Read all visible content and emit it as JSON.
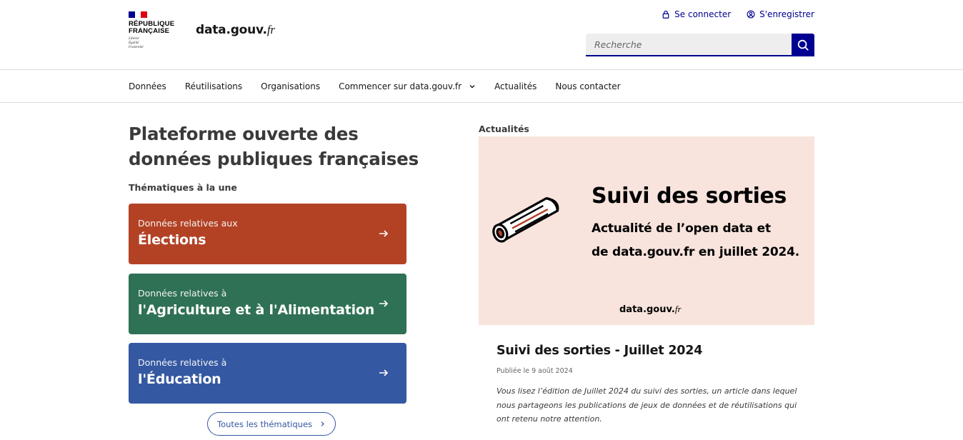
{
  "header": {
    "republique": "République\nFrançaise",
    "republique_lines": [
      "République",
      "Française"
    ],
    "devise_lines": [
      "Liberté",
      "Égalité",
      "Fraternité"
    ],
    "site_name": "data.gouv.",
    "site_tld": "fr",
    "login_label": "Se connecter",
    "register_label": "S'enregistrer",
    "search_placeholder": "Recherche",
    "flag_colors": [
      "#000091",
      "#ffffff",
      "#e1000f"
    ]
  },
  "nav": {
    "items": [
      {
        "label": "Données"
      },
      {
        "label": "Réutilisations"
      },
      {
        "label": "Organisations"
      },
      {
        "label": "Commencer sur data.gouv.fr",
        "has_dropdown": true
      },
      {
        "label": "Actualités"
      },
      {
        "label": "Nous contacter"
      }
    ]
  },
  "hero": {
    "title": "Plateforme ouverte des données publiques françaises",
    "themes_heading": "Thématiques à la une",
    "themes": [
      {
        "prefix": "Données relatives aux",
        "name": "Élections",
        "color": "#b34225"
      },
      {
        "prefix": "Données relatives à",
        "name": "l'Agriculture et à l'Alimentation",
        "color": "#2f7154"
      },
      {
        "prefix": "Données relatives à",
        "name": "l'Éducation",
        "color": "#3558a2"
      }
    ],
    "all_themes_label": "Toutes les thématiques"
  },
  "news": {
    "heading": "Actualités",
    "banner": {
      "title": "Suivi des sorties",
      "subtitle_line1": "Actualité de l’open data et",
      "subtitle_line2": "de data.gouv.fr en juillet 2024.",
      "logo_name": "data.gouv.",
      "logo_tld": "fr",
      "background": "#f8e4dd"
    },
    "article": {
      "title": "Suivi des sorties - Juillet 2024",
      "date": "Publiée le 9 août 2024",
      "excerpt": "Vous lisez l’édition de Juillet 2024 du suivi des sorties, un article dans lequel nous partageons les publications de jeux de données et de réutilisations qui ont retenu notre attention."
    }
  },
  "colors": {
    "accent": "#000091",
    "text": "#161616"
  }
}
